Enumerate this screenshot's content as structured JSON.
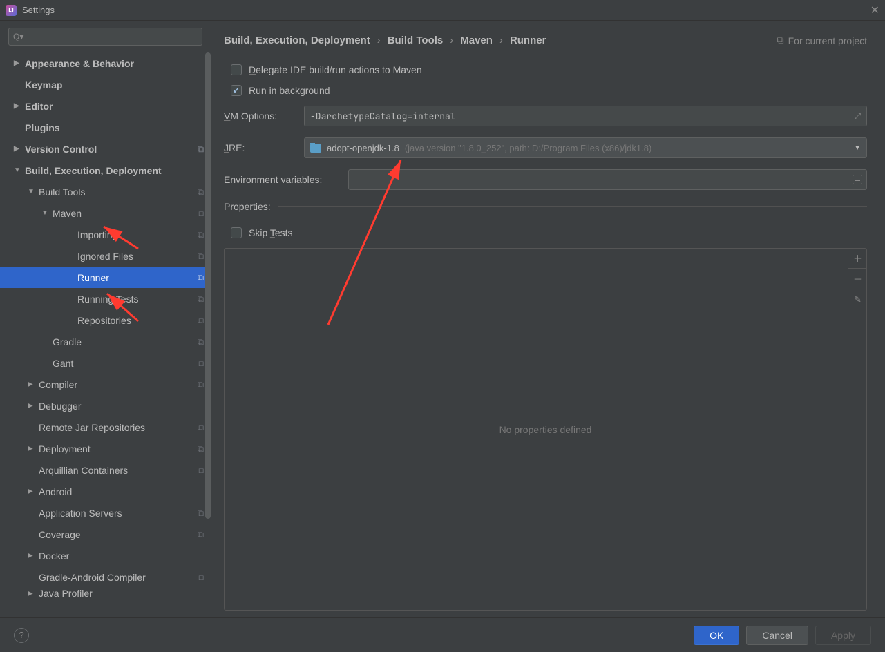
{
  "window": {
    "title": "Settings"
  },
  "close_glyph": "✕",
  "search_glyph": "Q▾",
  "sidebar": {
    "items": [
      {
        "label": "Appearance & Behavior",
        "indent": 0,
        "bold": true,
        "arrow": "right",
        "gear": false
      },
      {
        "label": "Keymap",
        "indent": 0,
        "bold": true,
        "arrow": "",
        "gear": false
      },
      {
        "label": "Editor",
        "indent": 0,
        "bold": true,
        "arrow": "right",
        "gear": false
      },
      {
        "label": "Plugins",
        "indent": 0,
        "bold": true,
        "arrow": "",
        "gear": false
      },
      {
        "label": "Version Control",
        "indent": 0,
        "bold": true,
        "arrow": "right",
        "gear": true
      },
      {
        "label": "Build, Execution, Deployment",
        "indent": 0,
        "bold": true,
        "arrow": "down",
        "gear": false
      },
      {
        "label": "Build Tools",
        "indent": 1,
        "bold": false,
        "arrow": "down",
        "gear": true
      },
      {
        "label": "Maven",
        "indent": 2,
        "bold": false,
        "arrow": "down",
        "gear": true
      },
      {
        "label": "Importing",
        "indent": 3,
        "bold": false,
        "arrow": "",
        "gear": true
      },
      {
        "label": "Ignored Files",
        "indent": 3,
        "bold": false,
        "arrow": "",
        "gear": true
      },
      {
        "label": "Runner",
        "indent": 3,
        "bold": false,
        "arrow": "",
        "gear": true,
        "selected": true
      },
      {
        "label": "Running Tests",
        "indent": 3,
        "bold": false,
        "arrow": "",
        "gear": true
      },
      {
        "label": "Repositories",
        "indent": 3,
        "bold": false,
        "arrow": "",
        "gear": true
      },
      {
        "label": "Gradle",
        "indent": 2,
        "bold": false,
        "arrow": "",
        "gear": true
      },
      {
        "label": "Gant",
        "indent": 2,
        "bold": false,
        "arrow": "",
        "gear": true
      },
      {
        "label": "Compiler",
        "indent": 1,
        "bold": false,
        "arrow": "right",
        "gear": true
      },
      {
        "label": "Debugger",
        "indent": 1,
        "bold": false,
        "arrow": "right",
        "gear": false
      },
      {
        "label": "Remote Jar Repositories",
        "indent": 1,
        "bold": false,
        "arrow": "",
        "gear": true
      },
      {
        "label": "Deployment",
        "indent": 1,
        "bold": false,
        "arrow": "right",
        "gear": true
      },
      {
        "label": "Arquillian Containers",
        "indent": 1,
        "bold": false,
        "arrow": "",
        "gear": true
      },
      {
        "label": "Android",
        "indent": 1,
        "bold": false,
        "arrow": "right",
        "gear": false
      },
      {
        "label": "Application Servers",
        "indent": 1,
        "bold": false,
        "arrow": "",
        "gear": true
      },
      {
        "label": "Coverage",
        "indent": 1,
        "bold": false,
        "arrow": "",
        "gear": true
      },
      {
        "label": "Docker",
        "indent": 1,
        "bold": false,
        "arrow": "right",
        "gear": false
      },
      {
        "label": "Gradle-Android Compiler",
        "indent": 1,
        "bold": false,
        "arrow": "",
        "gear": true
      },
      {
        "label": "Java Profiler",
        "indent": 1,
        "bold": false,
        "arrow": "right",
        "gear": false,
        "cut": true
      }
    ]
  },
  "breadcrumb": {
    "parts": [
      "Build, Execution, Deployment",
      "Build Tools",
      "Maven",
      "Runner"
    ],
    "scope_label": "For current project"
  },
  "checks": {
    "delegate": {
      "label": "Delegate IDE build/run actions to Maven",
      "checked": false,
      "u": "D"
    },
    "background": {
      "label": "Run in background",
      "checked": true,
      "u": "b"
    }
  },
  "form": {
    "vm_label": "VM Options:",
    "vm_u": "V",
    "vm_value": "-DarchetypeCatalog=internal",
    "jre_label": "JRE:",
    "jre_u": "J",
    "jre_name": "adopt-openjdk-1.8",
    "jre_detail": "(java version \"1.8.0_252\", path: D:/Program Files (x86)/jdk1.8)",
    "env_label": "Environment variables:",
    "env_u": "E",
    "props_label": "Properties:",
    "skip_label": "Skip Tests",
    "skip_u": "T",
    "empty_props": "No properties defined"
  },
  "tools": {
    "add": "＋",
    "remove": "－",
    "edit": "✎"
  },
  "footer": {
    "ok": "OK",
    "cancel": "Cancel",
    "apply": "Apply",
    "help": "?"
  }
}
